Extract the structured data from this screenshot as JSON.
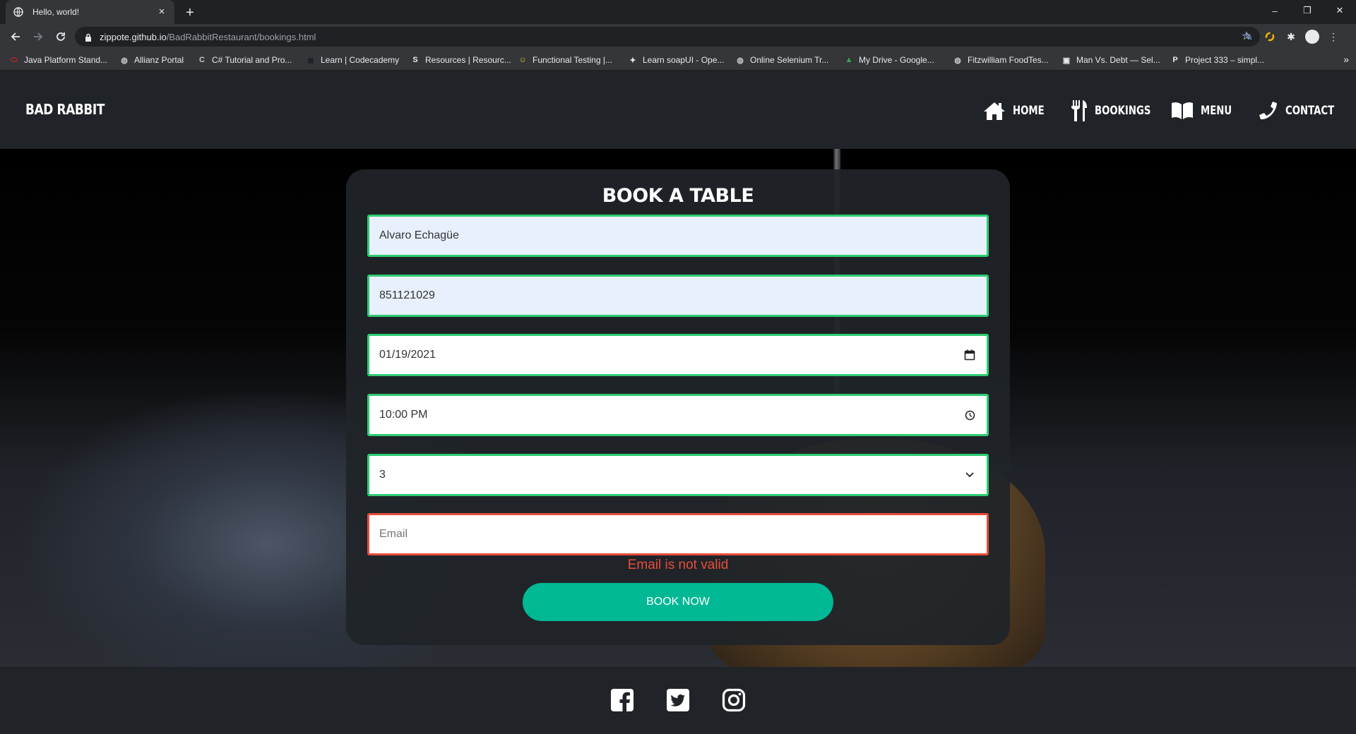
{
  "browser": {
    "tab_title": "Hello, world!",
    "tab_close": "×",
    "new_tab": "+",
    "window_controls": [
      "–",
      "❐",
      "✕"
    ],
    "url_host": "zippote.github.io",
    "url_path": "/BadRabbitRestaurant/bookings.html",
    "bookmarks": [
      {
        "label": "Java Platform Stand...",
        "icon": "oracle-icon",
        "color": "#e02020"
      },
      {
        "label": "Allianz Portal",
        "icon": "globe-icon",
        "color": "#c8c8c8"
      },
      {
        "label": "C# Tutorial and Pro...",
        "icon": "csharp-icon",
        "color": "#c8c8c8"
      },
      {
        "label": "Learn | Codecademy",
        "icon": "codecademy-icon",
        "color": "#1f2228"
      },
      {
        "label": "Resources | Resourc...",
        "icon": "s-icon",
        "color": "#e8eaed"
      },
      {
        "label": "Functional Testing |...",
        "icon": "smiley-icon",
        "color": "#d9c21e"
      },
      {
        "label": "Learn soapUI - Ope...",
        "icon": "soapui-icon",
        "color": "#e8eaed"
      },
      {
        "label": "Online Selenium Tr...",
        "icon": "globe-icon",
        "color": "#c8c8c8"
      },
      {
        "label": "My Drive - Google...",
        "icon": "drive-icon",
        "color": "#34a853"
      },
      {
        "label": "Fitzwilliam FoodTes...",
        "icon": "globe-icon",
        "color": "#c8c8c8"
      },
      {
        "label": "Man Vs. Debt — Sel...",
        "icon": "bookmark-page-icon",
        "color": "#e8eaed"
      },
      {
        "label": "Project 333 – simpl...",
        "icon": "p-icon",
        "color": "#e8eaed"
      }
    ],
    "bookmarks_more": "»"
  },
  "site": {
    "logo": "BAD RABBIT",
    "nav": [
      {
        "label": "HOME",
        "icon": "home-icon"
      },
      {
        "label": "BOOKINGS",
        "icon": "utensils-icon"
      },
      {
        "label": "MENU",
        "icon": "book-icon"
      },
      {
        "label": "CONTACT",
        "icon": "phone-icon"
      }
    ]
  },
  "form": {
    "title": "BOOK A TABLE",
    "name_value": "Alvaro Echagüe",
    "phone_value": "851121029",
    "date_value": "01/19/2021",
    "time_value": "10:00 PM",
    "guests_value": "3",
    "email_value": "",
    "email_placeholder": "Email",
    "email_error": "Email is not valid",
    "submit_label": "BOOK NOW"
  },
  "footer": {
    "social": [
      "facebook-icon",
      "twitter-icon",
      "instagram-icon"
    ]
  },
  "colors": {
    "accent": "#00b894",
    "valid_border": "#2ecc71",
    "invalid_border": "#e74c3c",
    "header_bg": "#202428"
  }
}
